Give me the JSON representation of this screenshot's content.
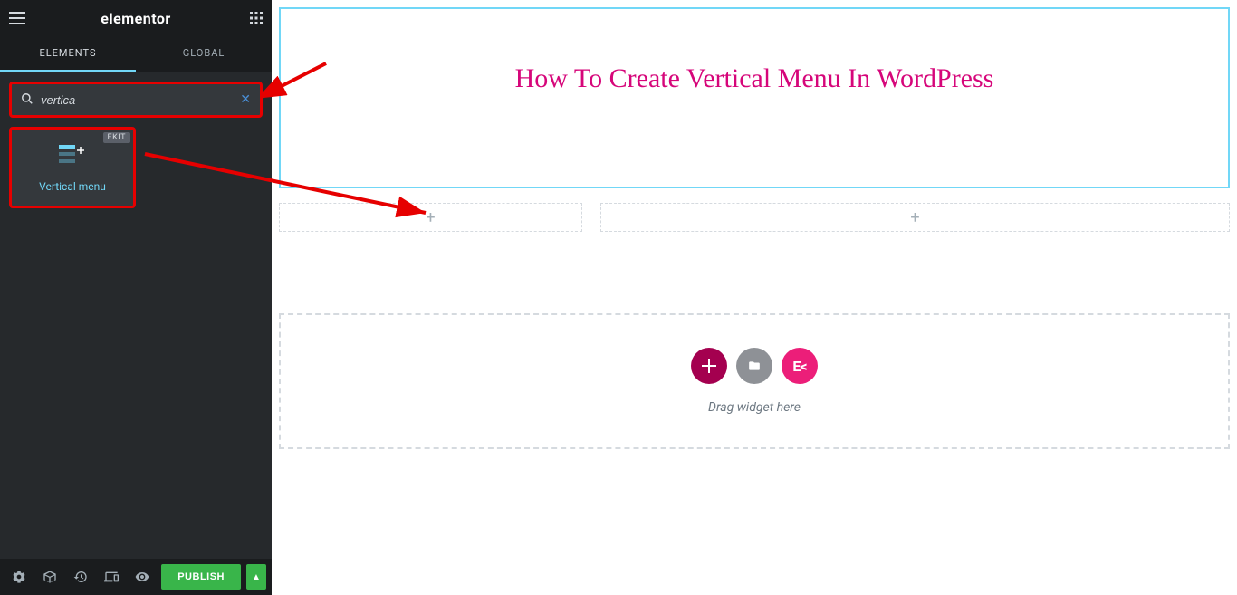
{
  "sidebar": {
    "logo": "elementor",
    "tabs": {
      "elements": "ELEMENTS",
      "global": "GLOBAL"
    },
    "search": {
      "value": "vertica"
    },
    "widget": {
      "badge": "EKIT",
      "label": "Vertical menu"
    },
    "footer": {
      "publish": "PUBLISH"
    }
  },
  "canvas": {
    "title": "How To Create Vertical Menu In WordPress",
    "drag_text": "Drag widget here"
  }
}
